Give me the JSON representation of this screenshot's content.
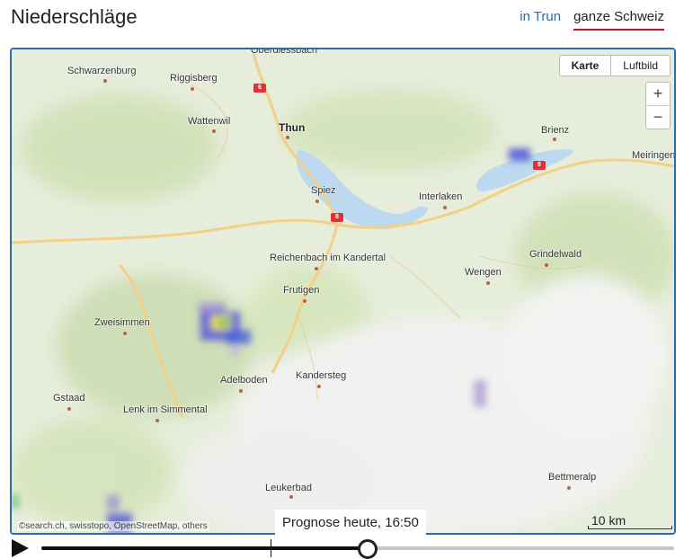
{
  "header": {
    "title": "Niederschläge",
    "tabs": [
      {
        "label": "in Trun",
        "active": false
      },
      {
        "label": "ganze Schweiz",
        "active": true
      }
    ]
  },
  "map": {
    "maptype_buttons": [
      {
        "label": "Karte",
        "selected": true
      },
      {
        "label": "Luftbild",
        "selected": false
      }
    ],
    "zoom_in": "+",
    "zoom_out": "−",
    "attribution": "©search.ch, swisstopo, OpenStreetMap, others",
    "scale_label": "10 km",
    "places": {
      "oberdiessbach": "Oberdiessbach",
      "schwarzenburg": "Schwarzenburg",
      "riggisberg": "Riggisberg",
      "wattenwil": "Wattenwil",
      "thun": "Thun",
      "brienz": "Brienz",
      "meiringen": "Meiringen",
      "spiez": "Spiez",
      "interlaken": "Interlaken",
      "grindelwald": "Grindelwald",
      "reichenbach": "Reichenbach im Kandertal",
      "wengen": "Wengen",
      "frutigen": "Frutigen",
      "zweisimmen": "Zweisimmen",
      "adelboden": "Adelboden",
      "kandersteg": "Kandersteg",
      "gstaad": "Gstaad",
      "lenk": "Lenk im Simmental",
      "bettmeralp": "Bettmeralp",
      "leukerbad": "Leukerbad"
    },
    "road_shields": [
      "6",
      "8",
      "8"
    ],
    "colors": {
      "water": "#bcd9ef",
      "forest": "#cfe0b4",
      "mountain": "#f1f1f1",
      "road": "#f4cf86",
      "frame": "#2a6db0",
      "tab_underline": "#c8102e"
    }
  },
  "timeline": {
    "play_icon": "play-icon",
    "tooltip": "Prognose heute, 16:50",
    "progress": 0.516
  }
}
